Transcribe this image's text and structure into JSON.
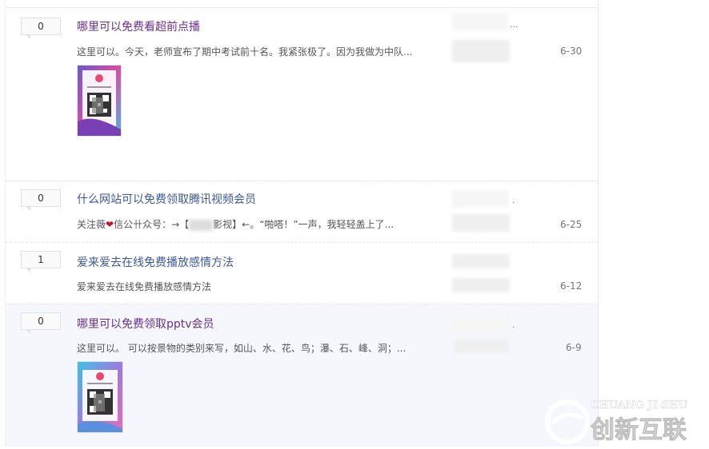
{
  "topics": [
    {
      "replies": "0",
      "title": "哪里可以免费看超前点播",
      "excerpt": "这里可以。今天，老师宣布了期中考试前十名。我紧张极了。因为我做为中队...",
      "date": "6-30",
      "ellipsis": "..."
    },
    {
      "replies": "0",
      "title": "什么网站可以免费领取腾讯视频会员",
      "excerpt_a": "关注薇",
      "excerpt_b": "信公卄众号：→【",
      "excerpt_c": "影视】←。“啪嗒！”一声，我轻轻盖上了...",
      "date": "6-25",
      "ellipsis": "."
    },
    {
      "replies": "1",
      "title": "爱来爱去在线免费播放感情方法",
      "excerpt": "爱来爱去在线免费播放感情方法",
      "date": "6-12"
    },
    {
      "replies": "0",
      "title": "哪里可以免费领取pptv会员",
      "excerpt": "这里可以。 可以按景物的类别来写，如山、水、花、鸟；瀑、石、峰、洞；...",
      "date": "6-9",
      "ellipsis": "."
    }
  ],
  "watermark": {
    "latin": "CHUANG JI SHU",
    "chinese": "创新互联"
  },
  "colors": {
    "link": "#3b5998",
    "visited": "#6b2f8e",
    "highlight_row": "#f5f7fc"
  }
}
